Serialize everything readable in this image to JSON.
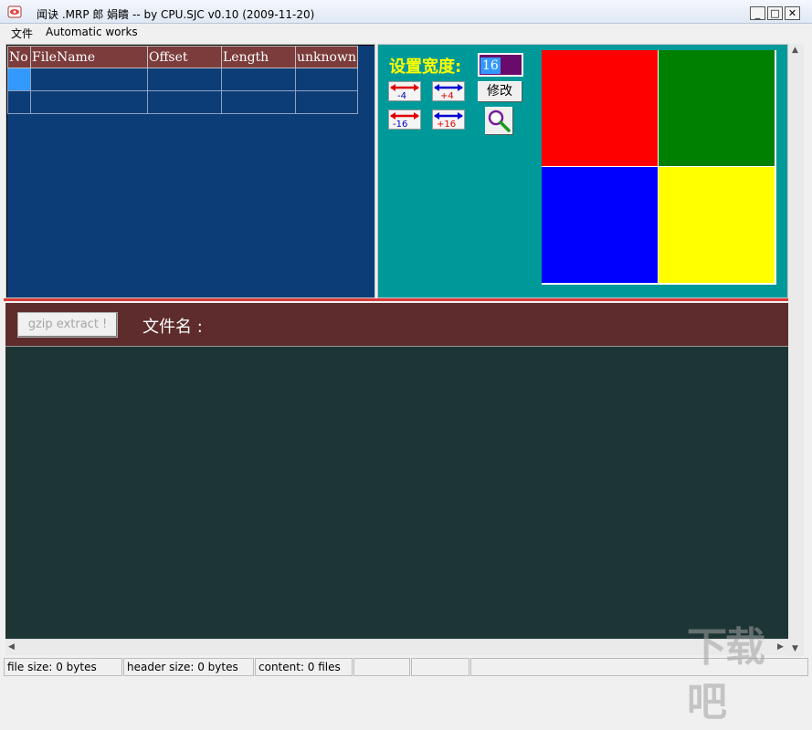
{
  "window": {
    "title": "闻诀 .MRP 郎   娟瞶 -- by CPU.SJC v0.10 (2009-11-20)",
    "minimize_label": "_",
    "maximize_label": "□",
    "close_label": "✕"
  },
  "menu": {
    "items": [
      "文件",
      "Automatic works"
    ]
  },
  "file_table": {
    "columns": [
      "No",
      "FileName",
      "Offset",
      "Length",
      "unknown"
    ],
    "rows": [
      [
        "",
        "",
        "",
        "",
        ""
      ],
      [
        "",
        "",
        "",
        "",
        ""
      ]
    ]
  },
  "width_control": {
    "label": "设置宽度:",
    "value": "16",
    "buttons": [
      "-4",
      "+4",
      "-16",
      "+16"
    ],
    "modify_label": "修改",
    "zoom_icon": "magnifier-icon"
  },
  "palette": {
    "colors": [
      "#ff0000",
      "#008000",
      "#0000ff",
      "#ffff00"
    ]
  },
  "toolbar": {
    "gzip_label": "gzip extract !",
    "filename_label": "文件名   :"
  },
  "status": {
    "file_size": "file size: 0 bytes",
    "header_size": "header size: 0 bytes",
    "content": "content: 0 files"
  },
  "watermark": {
    "text": "下载吧"
  }
}
